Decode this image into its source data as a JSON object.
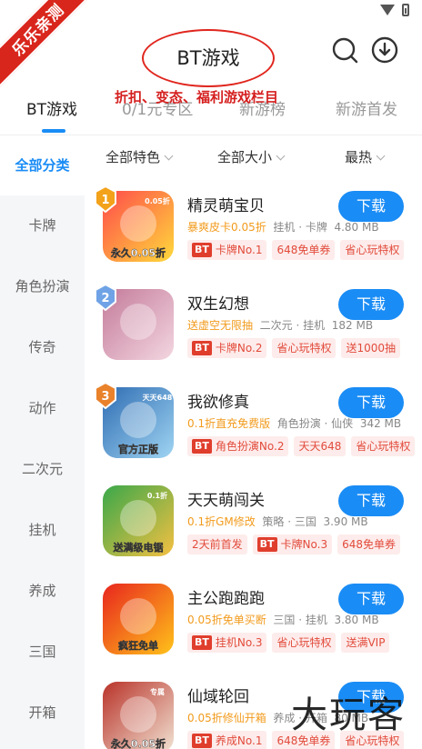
{
  "ribbon": "乐乐亲测",
  "header": {
    "title": "BT游戏",
    "annotation": "折扣、变态、福利游戏栏目"
  },
  "tabs": [
    {
      "label": "BT游戏",
      "active": true
    },
    {
      "label": "0/1元专区",
      "active": false
    },
    {
      "label": "新游榜",
      "active": false
    },
    {
      "label": "新游首发",
      "active": false
    }
  ],
  "sidebar": [
    {
      "label": "全部分类",
      "active": true
    },
    {
      "label": "卡牌"
    },
    {
      "label": "角色扮演"
    },
    {
      "label": "传奇"
    },
    {
      "label": "动作"
    },
    {
      "label": "二次元"
    },
    {
      "label": "挂机"
    },
    {
      "label": "养成"
    },
    {
      "label": "三国"
    },
    {
      "label": "开箱"
    }
  ],
  "filters": [
    "全部特色",
    "全部大小",
    "最热"
  ],
  "download_label": "下载",
  "games": [
    {
      "rank": "1",
      "name": "精灵萌宝贝",
      "highlight": "暴爽皮卡0.05折",
      "meta": "挂机 · 卡牌",
      "size": "4.80 MB",
      "tags": [
        {
          "bt": true,
          "text": "卡牌No.1"
        },
        {
          "bt": false,
          "text": "648免单券"
        },
        {
          "bt": false,
          "text": "省心玩特权"
        }
      ],
      "icon_colors": [
        "#ff4b4b",
        "#ffd93b"
      ],
      "icon_text": "永久0.05折",
      "icon_badge": "0.05折"
    },
    {
      "rank": "2",
      "name": "双生幻想",
      "highlight": "送虚空无限抽",
      "meta": "二次元 · 挂机",
      "size": "182 MB",
      "tags": [
        {
          "bt": true,
          "text": "卡牌No.2"
        },
        {
          "bt": false,
          "text": "省心玩特权"
        },
        {
          "bt": false,
          "text": "送1000抽"
        }
      ],
      "icon_colors": [
        "#c47b9a",
        "#f3d6e0"
      ],
      "icon_text": "",
      "icon_badge": ""
    },
    {
      "rank": "3",
      "name": "我欲修真",
      "highlight": "0.1折直充免费版",
      "meta": "角色扮演 · 仙侠",
      "size": "342 MB",
      "tags": [
        {
          "bt": true,
          "text": "角色扮演No.2"
        },
        {
          "bt": false,
          "text": "天天648"
        },
        {
          "bt": false,
          "text": "省心玩特权"
        }
      ],
      "icon_colors": [
        "#2f6db3",
        "#9fd4f2"
      ],
      "icon_text": "官方正版",
      "icon_badge": "天天648"
    },
    {
      "rank": "",
      "name": "天天萌闯关",
      "highlight": "0.1折GM修改",
      "meta": "策略 · 三国",
      "size": "3.90 MB",
      "tags": [
        {
          "bt": false,
          "text": "2天前首发"
        },
        {
          "bt": true,
          "text": "卡牌No.3"
        },
        {
          "bt": false,
          "text": "648免单券"
        }
      ],
      "icon_colors": [
        "#3aa84a",
        "#f4c042"
      ],
      "icon_text": "送满级电锯",
      "icon_badge": "0.1折"
    },
    {
      "rank": "",
      "name": "主公跑跑跑",
      "highlight": "0.05折免单买断",
      "meta": "三国 · 挂机",
      "size": "3.80 MB",
      "tags": [
        {
          "bt": true,
          "text": "挂机No.3"
        },
        {
          "bt": false,
          "text": "省心玩特权"
        },
        {
          "bt": false,
          "text": "送满VIP"
        }
      ],
      "icon_colors": [
        "#e8261e",
        "#ffc21a"
      ],
      "icon_text": "疯狂免单",
      "icon_badge": ""
    },
    {
      "rank": "",
      "name": "仙域轮回",
      "highlight": "0.05折修仙开箱",
      "meta": "养成 · 开箱",
      "size": "80 MB",
      "tags": [
        {
          "bt": true,
          "text": "养成No.1"
        },
        {
          "bt": false,
          "text": "648免单券"
        },
        {
          "bt": false,
          "text": "省心玩特权"
        }
      ],
      "icon_colors": [
        "#b9332a",
        "#f1e3d3"
      ],
      "icon_text": "永久0.05折",
      "icon_badge": "专属"
    }
  ],
  "watermark": "大玩客"
}
